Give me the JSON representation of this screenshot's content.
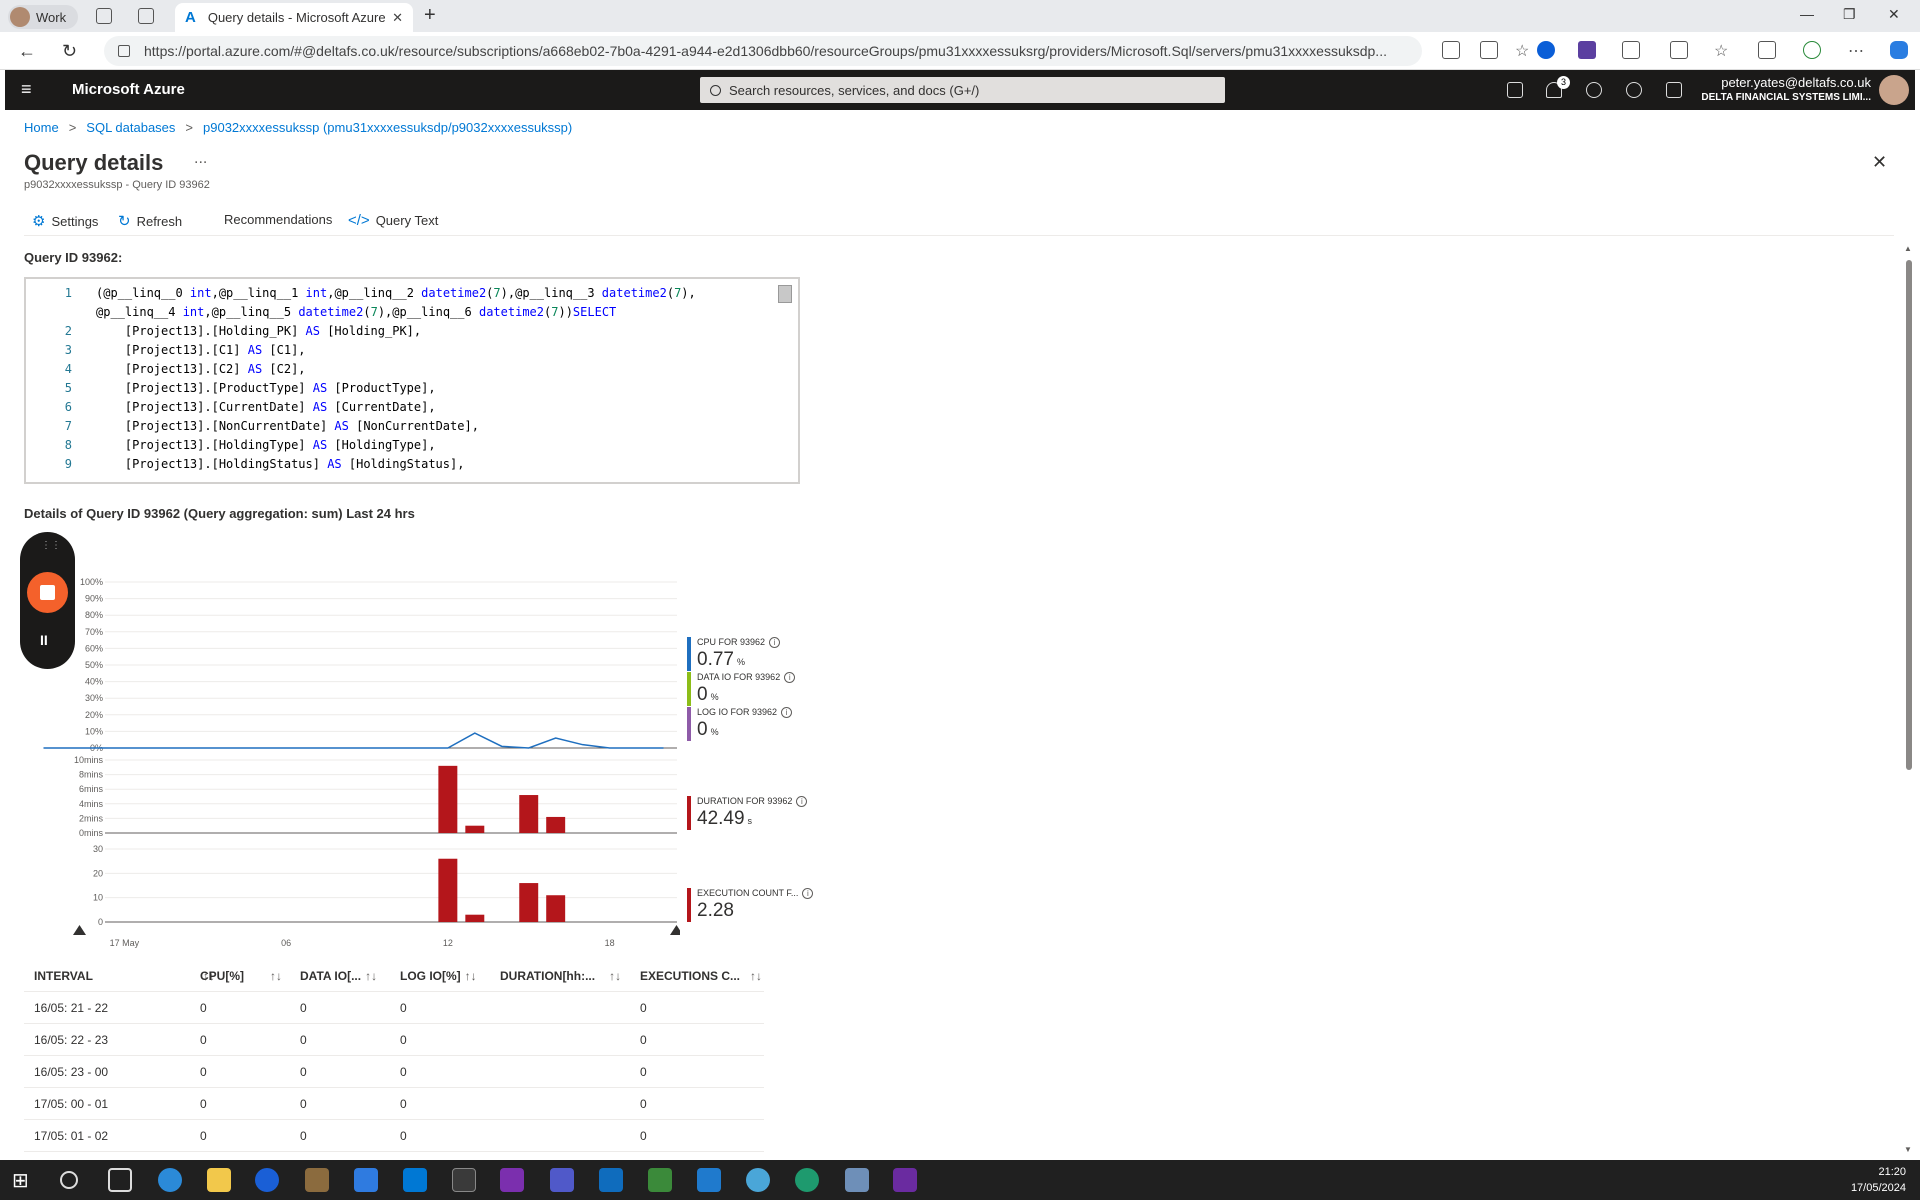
{
  "browser": {
    "profile_label": "Work",
    "tab_title": "Query details - Microsoft Azure",
    "url": "https://portal.azure.com/#@deltafs.co.uk/resource/subscriptions/a668eb02-7b0a-4291-a944-e2d1306dbb60/resourceGroups/pmu31xxxxessuksrg/providers/Microsoft.Sql/servers/pmu31xxxxessuksdp..."
  },
  "azure": {
    "brand": "Microsoft Azure",
    "search_placeholder": "Search resources, services, and docs (G+/)",
    "notification_count": "3",
    "user_email": "peter.yates@deltafs.co.uk",
    "user_org": "DELTA FINANCIAL SYSTEMS LIMI..."
  },
  "breadcrumb": [
    "Home",
    "SQL databases",
    "p9032xxxxessukssp (pmu31xxxxessuksdp/p9032xxxxessukssp)"
  ],
  "page": {
    "title": "Query details",
    "more": "...",
    "subtitle": "p9032xxxxessukssp - Query ID 93962"
  },
  "commands": {
    "settings": "Settings",
    "refresh": "Refresh",
    "recommendations": "Recommendations",
    "query_text": "Query Text"
  },
  "query": {
    "label": "Query ID 93962:",
    "line_numbers": [
      "1",
      "2",
      "3",
      "4",
      "5",
      "6",
      "7",
      "8",
      "9"
    ]
  },
  "details": {
    "label": "Details of Query ID 93962 (Query aggregation: sum) Last 24 hrs"
  },
  "legend": [
    {
      "label": "CPU FOR 93962",
      "value": "0.77",
      "unit": "%",
      "color": "#1f6fbf"
    },
    {
      "label": "DATA IO FOR 93962",
      "value": "0",
      "unit": "%",
      "color": "#8cbd18"
    },
    {
      "label": "LOG IO FOR 93962",
      "value": "0",
      "unit": "%",
      "color": "#8e5ba8"
    },
    {
      "label": "DURATION FOR 93962",
      "value": "42.49",
      "unit": "s",
      "color": "#b4161b"
    },
    {
      "label": "EXECUTION COUNT F...",
      "value": "2.28",
      "unit": "",
      "color": "#b4161b"
    }
  ],
  "chart_data": [
    {
      "type": "line",
      "name": "CPU",
      "yticks": [
        "100%",
        "90%",
        "80%",
        "70%",
        "60%",
        "50%",
        "40%",
        "30%",
        "20%",
        "10%",
        "0%"
      ],
      "ylim": [
        0,
        100
      ],
      "x": [
        "16/05 21",
        "16/05 22",
        "16/05 23",
        "17/05 00",
        "17/05 01",
        "17/05 02",
        "17/05 03",
        "17/05 04",
        "17/05 05",
        "17/05 06",
        "17/05 07",
        "17/05 08",
        "17/05 09",
        "17/05 10",
        "17/05 11",
        "17/05 12",
        "17/05 13",
        "17/05 14",
        "17/05 15",
        "17/05 16",
        "17/05 17",
        "17/05 18",
        "17/05 19",
        "17/05 20"
      ],
      "values": [
        0,
        0,
        0,
        0,
        0,
        0,
        0,
        0,
        0,
        0,
        0,
        0,
        0,
        0,
        0,
        0,
        9,
        1,
        0,
        6,
        2,
        0,
        0,
        0
      ],
      "color": "#1f6fbf"
    },
    {
      "type": "bar",
      "name": "Duration",
      "yticks": [
        "10mins",
        "8mins",
        "6mins",
        "4mins",
        "2mins",
        "0mins"
      ],
      "ylim": [
        0,
        10
      ],
      "x": [
        "16/05 21",
        "16/05 22",
        "16/05 23",
        "17/05 00",
        "17/05 01",
        "17/05 02",
        "17/05 03",
        "17/05 04",
        "17/05 05",
        "17/05 06",
        "17/05 07",
        "17/05 08",
        "17/05 09",
        "17/05 10",
        "17/05 11",
        "17/05 12",
        "17/05 13",
        "17/05 14",
        "17/05 15",
        "17/05 16",
        "17/05 17",
        "17/05 18",
        "17/05 19",
        "17/05 20"
      ],
      "values": [
        0,
        0,
        0,
        0,
        0,
        0,
        0,
        0,
        0,
        0,
        0,
        0,
        0,
        0,
        0,
        9.2,
        1,
        0,
        5.2,
        2.2,
        0,
        0,
        0,
        0
      ],
      "color": "#b4161b"
    },
    {
      "type": "bar",
      "name": "Execution count",
      "yticks": [
        "30",
        "20",
        "10",
        "0"
      ],
      "ylim": [
        0,
        30
      ],
      "x": [
        "16/05 21",
        "16/05 22",
        "16/05 23",
        "17/05 00",
        "17/05 01",
        "17/05 02",
        "17/05 03",
        "17/05 04",
        "17/05 05",
        "17/05 06",
        "17/05 07",
        "17/05 08",
        "17/05 09",
        "17/05 10",
        "17/05 11",
        "17/05 12",
        "17/05 13",
        "17/05 14",
        "17/05 15",
        "17/05 16",
        "17/05 17",
        "17/05 18",
        "17/05 19",
        "17/05 20"
      ],
      "values": [
        0,
        0,
        0,
        0,
        0,
        0,
        0,
        0,
        0,
        0,
        0,
        0,
        0,
        0,
        0,
        26,
        3,
        0,
        16,
        11,
        0,
        0,
        0,
        0
      ],
      "color": "#b4161b"
    }
  ],
  "xaxis_labels": [
    {
      "label": "17 May",
      "index": 3
    },
    {
      "label": "06",
      "index": 9
    },
    {
      "label": "12",
      "index": 15
    },
    {
      "label": "18",
      "index": 21
    }
  ],
  "table": {
    "headers": [
      "INTERVAL",
      "CPU[%]",
      "DATA IO[...",
      "LOG IO[%]",
      "DURATION[hh:...",
      "EXECUTIONS C..."
    ],
    "rows": [
      [
        "16/05: 21 - 22",
        "0",
        "0",
        "0",
        "",
        "0"
      ],
      [
        "16/05: 22 - 23",
        "0",
        "0",
        "0",
        "",
        "0"
      ],
      [
        "16/05: 23 - 00",
        "0",
        "0",
        "0",
        "",
        "0"
      ],
      [
        "17/05: 00 - 01",
        "0",
        "0",
        "0",
        "",
        "0"
      ],
      [
        "17/05: 01 - 02",
        "0",
        "0",
        "0",
        "",
        "0"
      ]
    ]
  },
  "clock": {
    "time": "21:20",
    "date": "17/05/2024"
  }
}
